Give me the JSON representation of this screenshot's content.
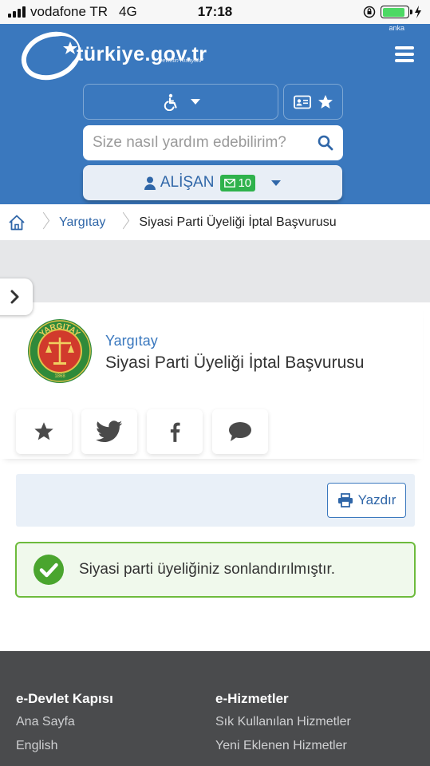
{
  "status_bar": {
    "carrier": "vodafone TR",
    "network": "4G",
    "time": "17:18"
  },
  "header": {
    "anka": "anka",
    "logo_text": "türkiye.gov.tr",
    "logo_subtitle": "\"Devletin Kısayolu\"",
    "search_placeholder": "Size nasıl yardım edebilirim?",
    "user_name": "ALİŞAN",
    "message_count": "10"
  },
  "breadcrumb": {
    "items": [
      "Yargıtay",
      "Siyasi Parti Üyeliği İptal Başvurusu"
    ]
  },
  "service": {
    "institution": "Yargıtay",
    "title": "Siyasi Parti Üyeliği İptal Başvurusu",
    "seal_text": "YARGITAY",
    "seal_year": "1868"
  },
  "actions": {
    "print_label": "Yazdır"
  },
  "alert": {
    "message": "Siyasi parti üyeliğiniz sonlandırılmıştır."
  },
  "footer": {
    "col1_title": "e-Devlet Kapısı",
    "col1_links": [
      "Ana Sayfa",
      "English"
    ],
    "col2_title": "e-Hizmetler",
    "col2_links": [
      "Sık Kullanılan Hizmetler",
      "Yeni Eklenen Hizmetler"
    ]
  },
  "colors": {
    "brand_blue": "#3a78be",
    "success_green": "#6dbb3c",
    "footer_gray": "#4a4b4d"
  }
}
